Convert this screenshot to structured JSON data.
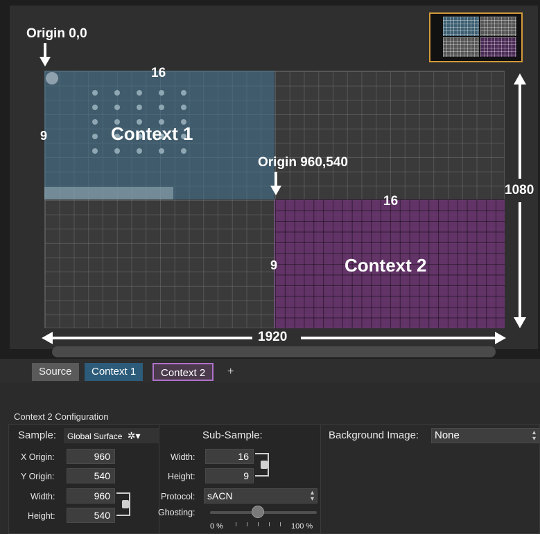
{
  "canvas": {
    "origin_label": "Origin 0,0",
    "origin2_label": "Origin 960,540",
    "ctx1_label": "Context 1",
    "ctx2_label": "Context 2",
    "ctx1_cols": "16",
    "ctx1_rows": "9",
    "ctx2_cols": "16",
    "ctx2_rows": "9",
    "total_width": "1920",
    "total_height": "1080"
  },
  "tabs": {
    "source": "Source",
    "context1": "Context 1",
    "context2": "Context 2",
    "add": "+"
  },
  "config": {
    "title": "Context 2 Configuration",
    "sample_label": "Sample:",
    "sample_value": "Global Surface",
    "x_origin_label": "X Origin:",
    "x_origin_value": "960",
    "y_origin_label": "Y Origin:",
    "y_origin_value": "540",
    "width_label": "Width:",
    "width_value": "960",
    "height_label": "Height:",
    "height_value": "540",
    "subsample_label": "Sub-Sample:",
    "sub_width_label": "Width:",
    "sub_width_value": "16",
    "sub_height_label": "Height:",
    "sub_height_value": "9",
    "protocol_label": "Protocol:",
    "protocol_value": "sACN",
    "ghosting_label": "Ghosting:",
    "ghost_min": "0 %",
    "ghost_max": "100 %",
    "ghosting_level": 0.45,
    "bg_image_label": "Background Image:",
    "bg_image_value": "None"
  },
  "colors": {
    "context1": "#2c5c7a",
    "context2": "#69326e",
    "minimap_border": "#d49a3a"
  }
}
